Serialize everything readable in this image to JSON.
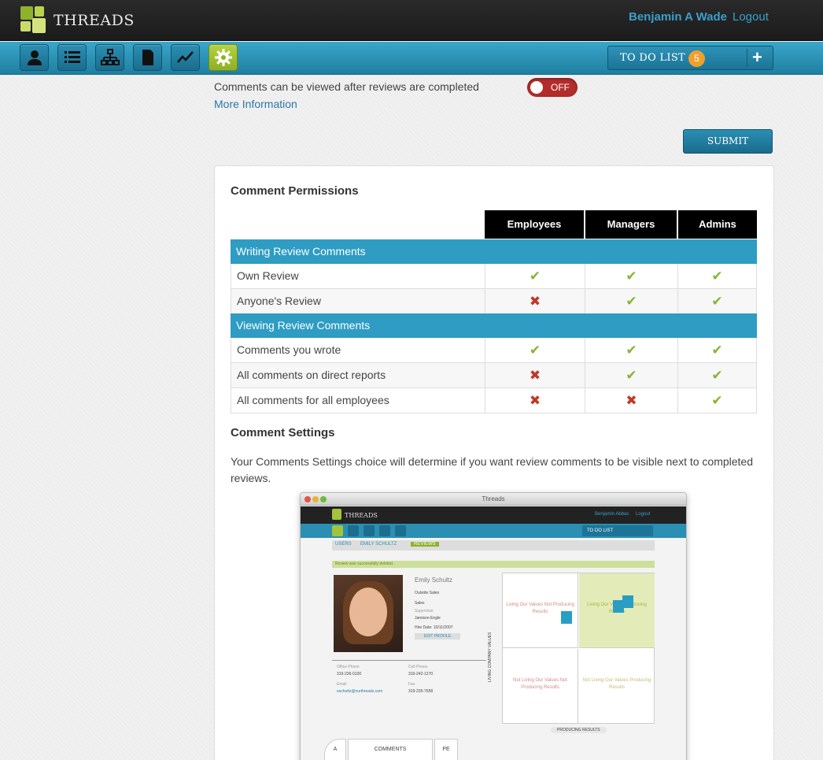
{
  "header": {
    "brand": "THREADS",
    "user_name": "Benjamin A Wade",
    "logout": "Logout"
  },
  "nav": {
    "icons": [
      "user-icon",
      "list-icon",
      "org-chart-icon",
      "document-icon",
      "chart-icon",
      "gear-icon"
    ],
    "active": "gear-icon",
    "todo_label": "TO DO LIST",
    "todo_count": "5",
    "todo_add": "+"
  },
  "settings": {
    "comments_text": "Comments can be viewed after reviews are completed",
    "more_info": "More Information",
    "toggle_state": "OFF",
    "submit": "SUBMIT"
  },
  "permissions": {
    "title": "Comment Permissions",
    "columns": [
      "Employees",
      "Managers",
      "Admins"
    ],
    "groups": [
      {
        "label": "Writing Review Comments",
        "rows": [
          {
            "label": "Own Review",
            "values": [
              true,
              true,
              true
            ]
          },
          {
            "label": "Anyone's Review",
            "values": [
              false,
              true,
              true
            ]
          }
        ]
      },
      {
        "label": "Viewing Review Comments",
        "rows": [
          {
            "label": "Comments you wrote",
            "values": [
              true,
              true,
              true
            ]
          },
          {
            "label": "All comments on direct reports",
            "values": [
              false,
              true,
              true
            ]
          },
          {
            "label": "All comments for all employees",
            "values": [
              false,
              false,
              true
            ]
          }
        ]
      }
    ],
    "yes_symbol": "✔",
    "no_symbol": "✖"
  },
  "comment_settings": {
    "title": "Comment Settings",
    "description": "Your Comments Settings choice will determine if you want review comments to be visible next to completed reviews."
  },
  "preview": {
    "window_title": "Threads",
    "brand": "THREADS",
    "user": "Benjamin Abbas",
    "logout": "Logout",
    "todo": "TO DO LIST",
    "crumbs": [
      "USERS",
      "EMILY SCHULTZ",
      "REVIEWS"
    ],
    "alert": "Review was successfully deleted.",
    "employee_name": "Emily Schultz",
    "dept": "Outside Sales",
    "team": "Sales",
    "supervisor_label": "Supervisor",
    "supervisor": "Jamison Engle",
    "hire_date": "Hire Date: 10/11/2007",
    "edit_profile": "EDIT PROFILE",
    "office_phone_label": "Office Phone",
    "office_phone": "319-236-0100",
    "cell_phone_label": "Cell Phone",
    "cell_phone": "319-242-1270",
    "email_label": "Email",
    "email": "eschultz@ourthreads.com",
    "fax_label": "Fax",
    "fax": "319-235-7658",
    "quadrants": [
      "Living Our Values Not Producing Results",
      "Living Our Values Producing Results",
      "Not Living Our Values Not Producing Results",
      "Not Living Our Values Producing Results"
    ],
    "axis_y": "LIVING COMPANY VALUES",
    "axis_x": "PRODUCING RESULTS",
    "tabs": [
      "A",
      "COMMENTS",
      "PE"
    ]
  },
  "colors": {
    "accent_blue": "#2e9cc3",
    "brand_green": "#a3c33b",
    "check_green": "#8ab336",
    "cross_red": "#c0392b",
    "toggle_red": "#b32c2c"
  }
}
